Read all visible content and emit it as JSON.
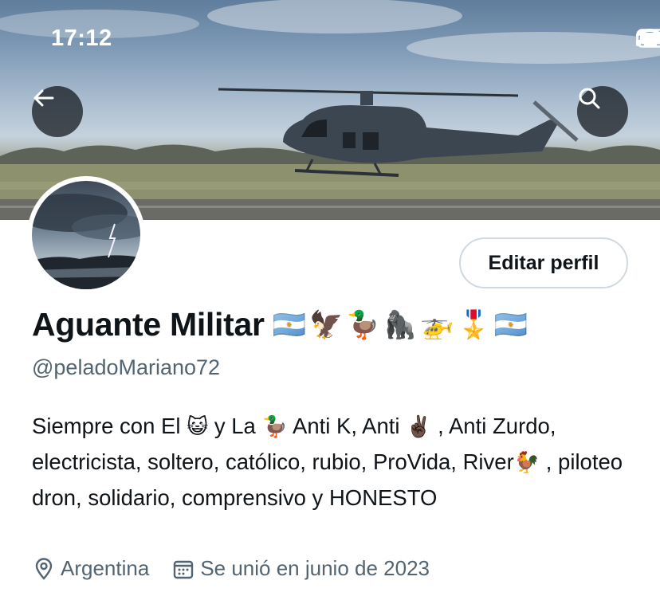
{
  "status_bar": {
    "time": "17:12"
  },
  "header": {
    "back_icon": "arrow-left-icon",
    "search_icon": "search-icon"
  },
  "profile": {
    "display_name": "Aguante Militar",
    "name_emojis": "🇦🇷🦅🦆🦍🚁🎖️🇦🇷",
    "handle": "@peladoMariano72",
    "edit_button": "Editar perfil",
    "bio": {
      "part1": "Siempre con El ",
      "emoji1": "😺",
      "part2": " y La ",
      "emoji2": "🦆",
      "part3": " Anti K, Anti ",
      "emoji3": "✌🏿",
      "part4": " , Anti Zurdo, electricista, soltero, católico, rubio, ProVida, River",
      "emoji4": "🐓",
      "part5": " , piloteo dron, solidario, comprensivo y HONESTO"
    },
    "location": "Argentina",
    "joined": "Se unió en junio de 2023"
  },
  "colors": {
    "text_primary": "#0f1419",
    "text_secondary": "#536471",
    "border": "#cfd9de"
  }
}
